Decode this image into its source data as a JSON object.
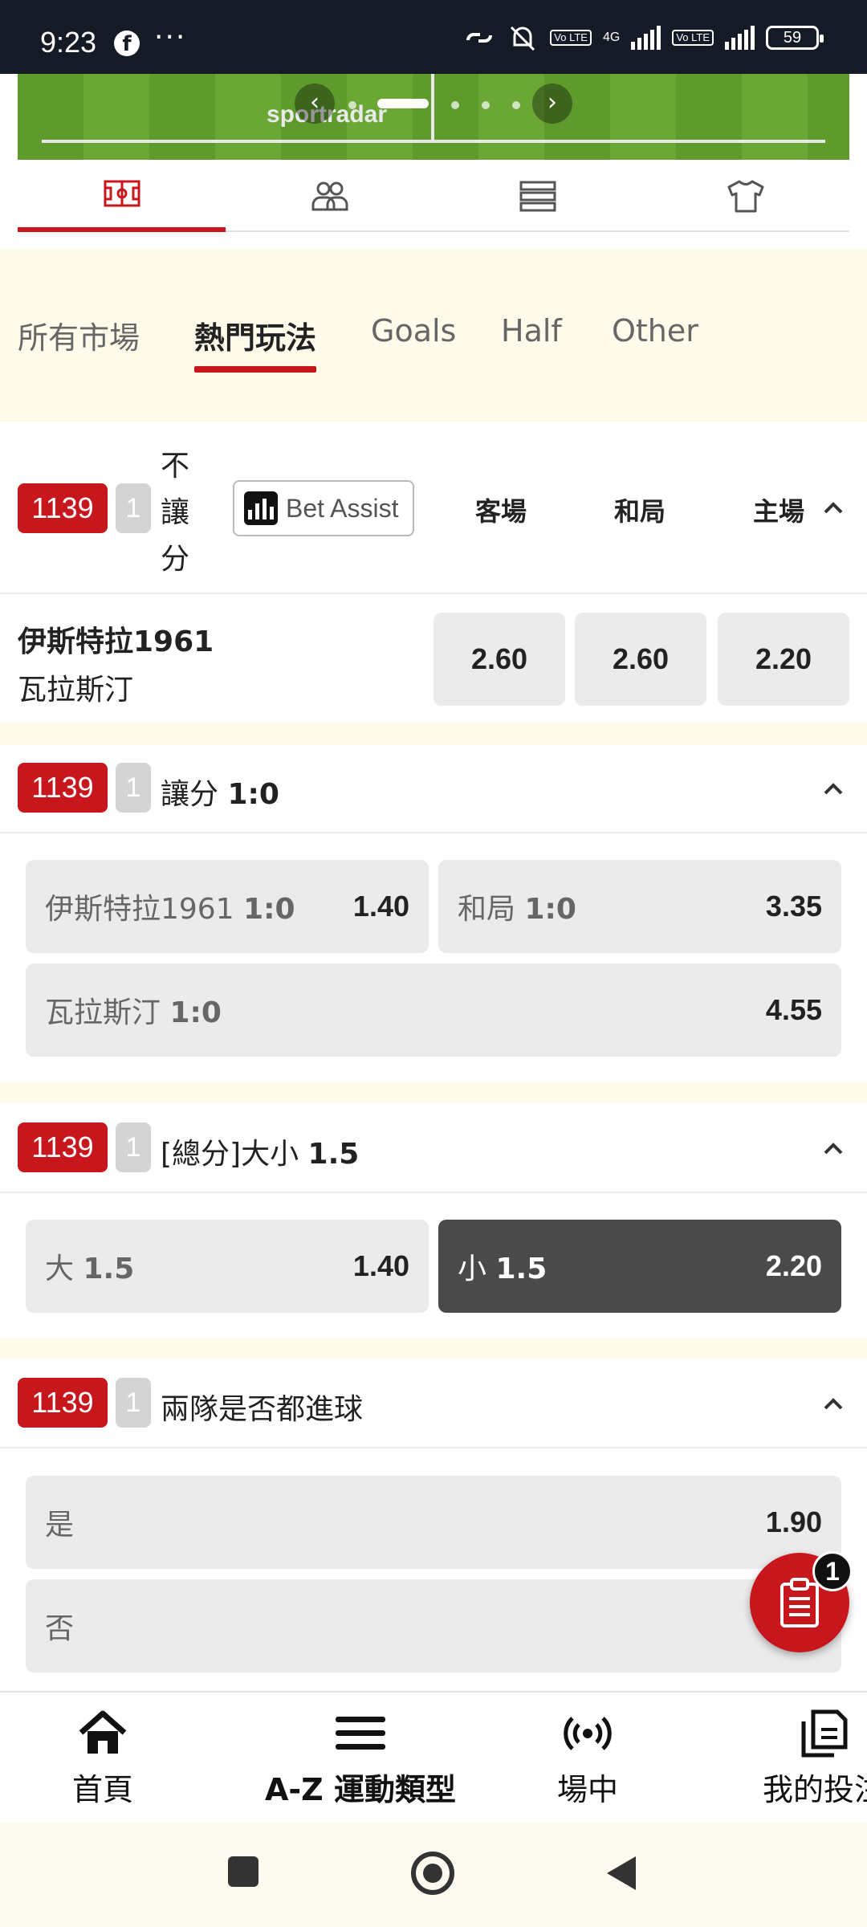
{
  "status_bar": {
    "time": "9:23",
    "lte1": "Vo LTE",
    "net": "4G",
    "lte2": "Vo LTE",
    "battery": "59"
  },
  "tracker": {
    "brand": "sportradar",
    "prev": "‹",
    "next": "›"
  },
  "icon_tabs": [
    {
      "name": "pitch-icon",
      "active": true
    },
    {
      "name": "lineup-icon",
      "active": false
    },
    {
      "name": "stats-icon",
      "active": false
    },
    {
      "name": "jersey-icon",
      "active": false
    }
  ],
  "categories": [
    "所有市場",
    "熱門玩法",
    "Goals",
    "Half",
    "Other"
  ],
  "markets": {
    "m1": {
      "id": "1139",
      "num": "1",
      "title": "不\n讓\n分",
      "bet_assist": "Bet Assist",
      "cols": [
        "客場",
        "和局",
        "主場"
      ],
      "team1": "伊斯特拉1961",
      "team2": "瓦拉斯汀",
      "odds": [
        "2.60",
        "2.60",
        "2.20"
      ]
    },
    "m2": {
      "id": "1139",
      "num": "1",
      "title": "讓分",
      "title_bold": "1:0",
      "opts": [
        {
          "label": "伊斯特拉1961",
          "label_bold": "1:0",
          "odd": "1.40"
        },
        {
          "label": "和局",
          "label_bold": "1:0",
          "odd": "3.35"
        },
        {
          "label": "瓦拉斯汀",
          "label_bold": "1:0",
          "odd": "4.55"
        }
      ]
    },
    "m3": {
      "id": "1139",
      "num": "1",
      "title": "[總分]大小",
      "title_bold": "1.5",
      "opts": [
        {
          "label": "大",
          "label_bold": "1.5",
          "odd": "1.40"
        },
        {
          "label": "小",
          "label_bold": "1.5",
          "odd": "2.20"
        }
      ]
    },
    "m4": {
      "id": "1139",
      "num": "1",
      "title": "兩隊是否都進球",
      "opts": [
        {
          "label": "是",
          "odd": "1.90"
        },
        {
          "label": "否",
          "odd": ""
        }
      ]
    }
  },
  "betslip": {
    "count": "1"
  },
  "bottom_nav": [
    {
      "label": "首頁"
    },
    {
      "label": "A-Z 運動類型"
    },
    {
      "label": "場中"
    },
    {
      "label": "我的投注"
    }
  ],
  "colors": {
    "accent": "#c8161d",
    "cream": "#fefbea",
    "statusbar": "#151b26"
  }
}
